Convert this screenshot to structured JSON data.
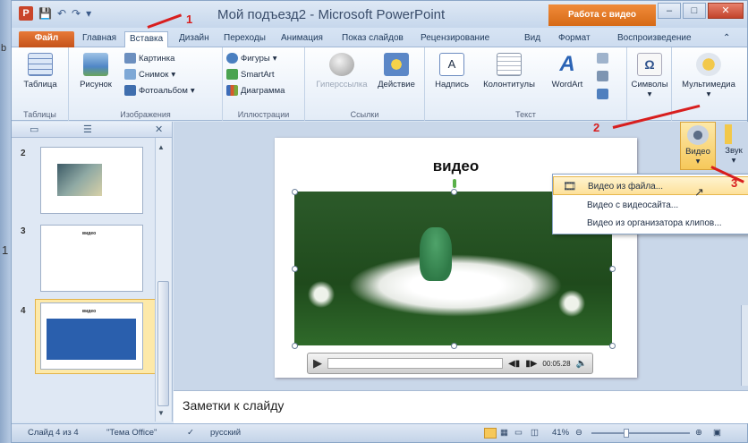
{
  "window": {
    "title": "Мой подъезд2 - Microsoft PowerPoint",
    "context_tab": "Работа с видео"
  },
  "tabs": [
    "Файл",
    "Главная",
    "Вставка",
    "Дизайн",
    "Переходы",
    "Анимация",
    "Показ слайдов",
    "Рецензирование",
    "Вид",
    "Формат",
    "Воспроизведение"
  ],
  "ribbon": {
    "tables": {
      "btn": "Таблица",
      "label": "Таблицы"
    },
    "images": {
      "picture": "Рисунок",
      "clipart": "Картинка",
      "screenshot": "Снимок",
      "album": "Фотоальбом",
      "label": "Изображения"
    },
    "illustrations": {
      "shapes": "Фигуры",
      "smartart": "SmartArt",
      "chart": "Диаграмма",
      "label": "Иллюстрации"
    },
    "links": {
      "hyperlink": "Гиперссылка",
      "action": "Действие",
      "label": "Ссылки"
    },
    "text": {
      "textbox": "Надпись",
      "header": "Колонтитулы",
      "wordart": "WordArt",
      "label": "Текст"
    },
    "symbols": {
      "btn": "Символы"
    },
    "media": {
      "btn": "Мультимедиа",
      "video": "Видео",
      "sound": "Звук"
    }
  },
  "dropdown": [
    "Видео из файла...",
    "Видео с видеосайта...",
    "Видео из организатора клипов..."
  ],
  "slides": {
    "thumb3_text": "видео",
    "thumb4_text": "видео",
    "numbers": [
      "2",
      "3",
      "4"
    ]
  },
  "slide": {
    "title": "видео",
    "time": "00:05.28"
  },
  "notes": "Заметки к слайду",
  "status": {
    "slide": "Слайд 4 из 4",
    "theme": "\"Тема Office\"",
    "lang": "русский",
    "zoom": "41%"
  },
  "annotations": [
    "1",
    "2",
    "3"
  ],
  "leftedge": {
    "text1": "b",
    "text2": "1"
  }
}
